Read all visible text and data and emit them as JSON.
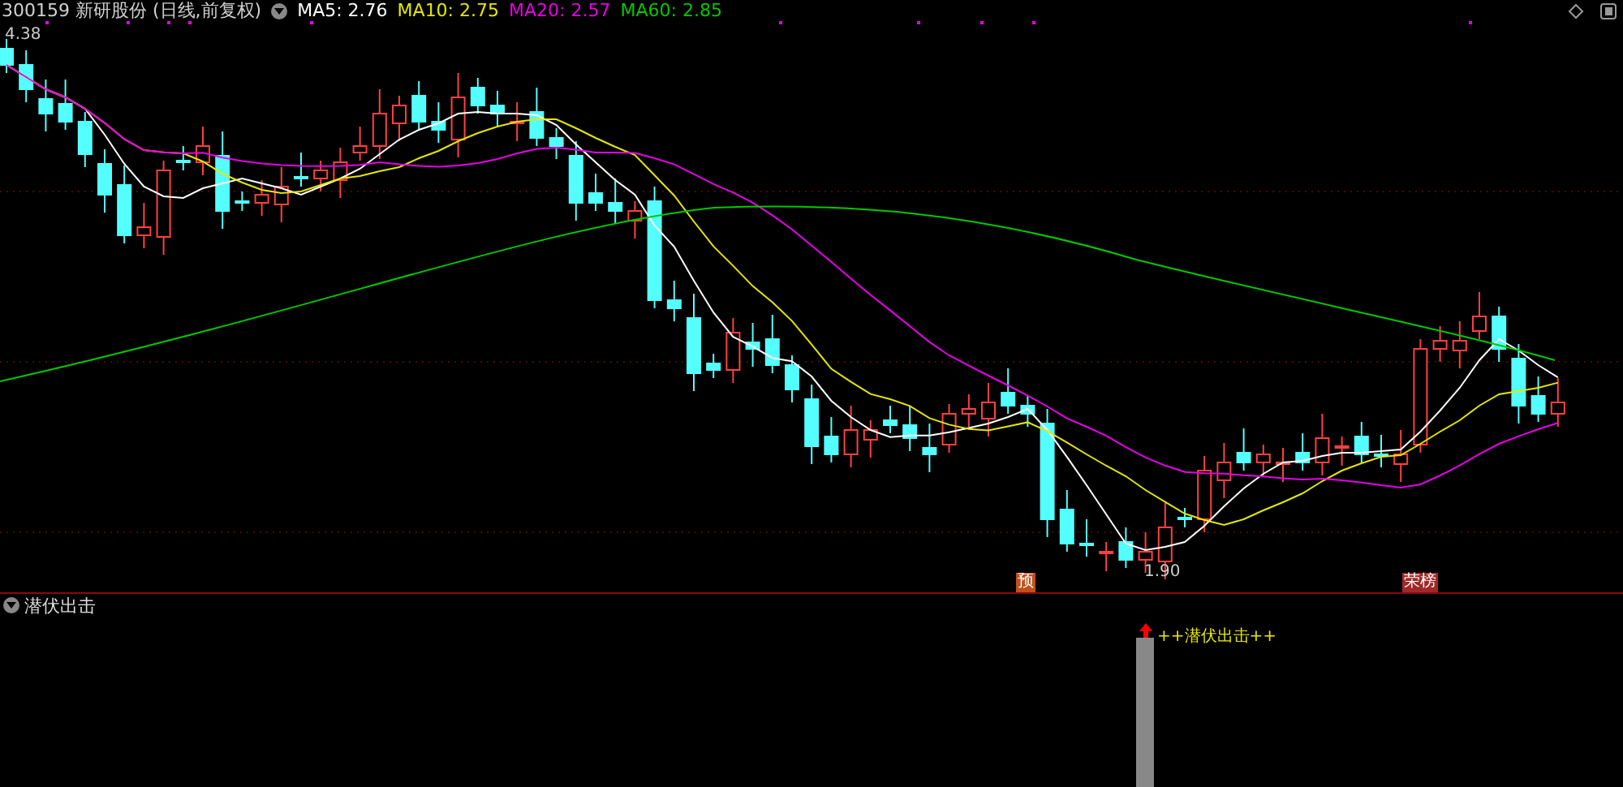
{
  "header": {
    "title": "300159 新研股份 (日线,前复权)",
    "ma_legend": [
      {
        "label": "MA5: 2.76",
        "color": "#ffffff"
      },
      {
        "label": "MA10: 2.75",
        "color": "#e6e600"
      },
      {
        "label": "MA20: 2.57",
        "color": "#e600e6"
      },
      {
        "label": "MA60: 2.85",
        "color": "#00c800"
      }
    ]
  },
  "main_chart": {
    "high_label": "4.38",
    "low_label": "1.90",
    "markers": [
      {
        "text": "预",
        "color": "#c0501c"
      },
      {
        "text": "荣榜",
        "color": "#a02828"
      }
    ]
  },
  "indicator": {
    "name": "潜伏出击",
    "signal": "++潜伏出击++"
  }
}
